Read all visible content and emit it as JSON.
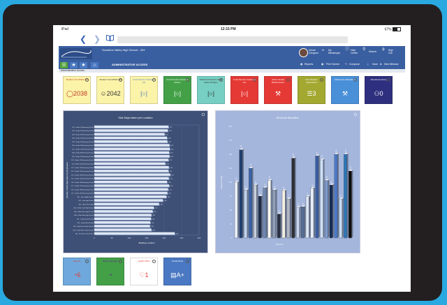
{
  "status": {
    "device": "iPad",
    "time": "12:15 PM",
    "battery": "67%"
  },
  "header": {
    "school": "Sunshine Valley High School - 403",
    "user_name": "Vinnie Gergand",
    "messenger": "My Messenger",
    "help": "Help Center",
    "search": "Search",
    "signout": "Sign Out"
  },
  "toolbar": {
    "section": "ADMINISTRATIVE ACCESS",
    "reports": "Reports",
    "print_screen": "Print Screen",
    "compose": "Compose",
    "save": "Save",
    "new_window": "New Window"
  },
  "breadcrumb": "Administrative Access",
  "tiles": [
    {
      "title": "Student Count/Date Fill",
      "value": "2038",
      "icon": "ring-icon",
      "bg": "#fbf3a8",
      "fg": "#c0392b"
    },
    {
      "title": "Student Count/Date Fill",
      "value": "2042",
      "icon": "user-icon",
      "bg": "#fbf3a8",
      "fg": "#333333"
    },
    {
      "title": "Food Service Customer List",
      "value": "",
      "icon": "fork-knife-icon",
      "bg": "#fbf3a8",
      "fg": "#4a78c2"
    },
    {
      "title": "Food Service Purchase History",
      "value": "",
      "icon": "fork-knife-icon",
      "bg": "#43a047",
      "fg": "#ffffff"
    },
    {
      "title": "Total Food Service Sales (Past 30 days)",
      "value": "",
      "icon": "fork-knife-icon",
      "bg": "#77cfc3",
      "fg": "#2b2b2b"
    },
    {
      "title": "Food Service Customer List",
      "value": "",
      "icon": "fork-knife-icon",
      "bg": "#e53935",
      "fg": "#ffffff"
    },
    {
      "title": "Active Global Misdemeanor",
      "value": "",
      "icon": "gavel-icon",
      "bg": "#e53935",
      "fg": "#ffffff"
    },
    {
      "title": "New Student Applications",
      "value": "3",
      "icon": "books-icon",
      "bg": "#a3a830",
      "fg": "#ffffff"
    },
    {
      "title": "Classroom Attendance",
      "value": "",
      "icon": "gavel-icon",
      "bg": "#4a90d9",
      "fg": "#ffffff"
    },
    {
      "title": "Attendance Entry",
      "value": "0",
      "icon": "users-icon",
      "bg": "#2e2f7e",
      "fg": "#ffffff"
    }
  ],
  "bottom_tiles": [
    {
      "title": "Reports",
      "value": "6",
      "icon": "pie-icon",
      "bg": "#6fa8dc",
      "fg": "#e53935"
    },
    {
      "title": "Report Manager",
      "value": "",
      "icon": "pie-icon",
      "bg": "#43a047",
      "fg": "#6a1b9a"
    },
    {
      "title": "Health Office",
      "value": "1",
      "icon": "heart-icon",
      "bg": "#ffffff",
      "fg": "#e53935"
    },
    {
      "title": "Grade Book",
      "value": "A+",
      "icon": "grade-icon",
      "bg": "#4a78c2",
      "fg": "#ffffff"
    }
  ],
  "chart_data": [
    {
      "type": "bar",
      "orientation": "horizontal",
      "title": "Sick Days taken per Location",
      "xlabel": "Building Location",
      "ylabel": "Number of sick days taken by Employees",
      "xlim": [
        0,
        300
      ],
      "xticks": [
        "0",
        "50",
        "100",
        "150",
        "200",
        "250",
        "300"
      ],
      "categories": [
        "101 - Grade 1 Elementary School",
        "102 - Grade 2 Elementary School",
        "103 - Grade 3 Elementary School",
        "104 - Grade 4 Elementary School",
        "105 - Grade 5 Elementary School",
        "106 - Grade 6 Elementary School",
        "107 - Grade 7 Elementary School",
        "108 - Grade 8 Elementary School",
        "109 - Grade 9 Elementary School",
        "110 - Grade 10 Elementary School",
        "111 - Grade 11 Elementary School",
        "112 - Grade 12 Elementary School",
        "113 - Grade 13 Elementary School",
        "114 - Grade 14 Elementary School",
        "115 - Grade 15 Elementary School",
        "116 - Grade 16 Elementary School",
        "117 - Grade 17 Elementary School",
        "118 - Grade 18 Elementary School",
        "119 - Grade 19 Elementary School",
        "401 - Bern Middle School",
        "402 - Jake High School",
        "403 - Glebe North High",
        "404 - Glebe South High School",
        "405 - Glebe West High School",
        "406 - Glebe Main High School",
        "501 - Grade South School",
        "502 - Grade West School",
        "503 - Grade East Grade School",
        "504 - Grade West Grade School",
        "900 - POLICE Central Office"
      ],
      "values": [
        212,
        210,
        201,
        208,
        209,
        215,
        216,
        214,
        215,
        212,
        203,
        213,
        212,
        217,
        213,
        208,
        214,
        211,
        209,
        206,
        196,
        185,
        170,
        167,
        163,
        162,
        160,
        159,
        163,
        230
      ],
      "data_labels": [
        "212",
        "210",
        "201",
        "208",
        "209",
        "215",
        "216",
        "214",
        "215",
        "212",
        "203",
        "213",
        "212",
        "217",
        "213",
        "208",
        "214",
        "211",
        "209",
        "206",
        "196",
        "185",
        "170",
        "167",
        "163",
        "162",
        "160",
        "159",
        "163",
        "230"
      ]
    },
    {
      "type": "bar",
      "title": "Revenue Allocation",
      "xlabel": "Account",
      "ylabel": "Revenue Code",
      "ylim": [
        0,
        200
      ],
      "yticks": [
        "0",
        "25",
        "50",
        "75",
        "100",
        "125",
        "150",
        "175",
        "200"
      ],
      "values": [
        100,
        158,
        86,
        125,
        95,
        75,
        90,
        103,
        86,
        43,
        85,
        70,
        143,
        55,
        56,
        74,
        89,
        147,
        140,
        103,
        95,
        150,
        70,
        150,
        120
      ],
      "data_labels": [
        "100",
        "158",
        "86",
        "125",
        "95",
        "75",
        "90",
        "103",
        "86",
        "43",
        "85",
        "70",
        "143",
        "55",
        "56",
        "74",
        "89",
        "147",
        "140",
        "103",
        "95",
        "150",
        "70",
        "150",
        "120"
      ],
      "colors": [
        "#e9eff8",
        "#1f3f70",
        "#c0d4ee",
        "#3b64a8",
        "#c7cfdc",
        "#1e2d4a",
        "#6f86b0",
        "#fdfcf4",
        "#8fa0b8",
        "#2a3144",
        "#f4f0e4",
        "#b0b7c4",
        "#2e2f33",
        "#c8d6ee",
        "#556e96",
        "#dde7f7",
        "#e7eef9",
        "#3a5ea5",
        "#cfe1f7",
        "#7d9cd0",
        "#162c55",
        "#4b7ac8",
        "#c6dcf2",
        "#2f77b8",
        "#0c0c0e"
      ]
    }
  ]
}
